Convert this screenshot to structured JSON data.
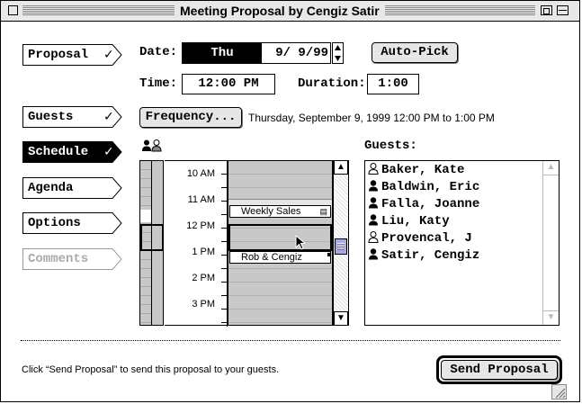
{
  "window": {
    "title": "Meeting Proposal by Cengiz Satir"
  },
  "nav": {
    "items": [
      {
        "label": "Proposal",
        "check": "✓",
        "selected": false,
        "disabled": false
      },
      {
        "label": "Guests",
        "check": "✓",
        "selected": false,
        "disabled": false
      },
      {
        "label": "Schedule",
        "check": "✓",
        "selected": true,
        "disabled": false
      },
      {
        "label": "Agenda",
        "check": "",
        "selected": false,
        "disabled": false
      },
      {
        "label": "Options",
        "check": "",
        "selected": false,
        "disabled": false
      },
      {
        "label": "Comments",
        "check": "",
        "selected": false,
        "disabled": true
      }
    ]
  },
  "proposal": {
    "date_label": "Date:",
    "day": "Thu",
    "date_value": "9/ 9/99",
    "auto_pick_label": "Auto-Pick",
    "time_label": "Time:",
    "time_value": "12:00 PM",
    "duration_label": "Duration:",
    "duration_value": "1:00",
    "frequency_label": "Frequency...",
    "summary": "Thursday, September 9, 1999 12:00 PM to  1:00 PM"
  },
  "schedule": {
    "times": [
      "10 AM",
      "11 AM",
      "12 PM",
      "1 PM",
      "2 PM",
      "3 PM"
    ],
    "events": [
      {
        "label": "Weekly Sales"
      },
      {
        "label": "Rob & Cengiz"
      }
    ]
  },
  "guests": {
    "label": "Guests:",
    "list": [
      {
        "name": "Baker, Kate",
        "icon": "person-outline-icon"
      },
      {
        "name": "Baldwin, Eric",
        "icon": "person-icon"
      },
      {
        "name": "Falla, Joanne",
        "icon": "person-icon"
      },
      {
        "name": "Liu, Katy",
        "icon": "person-icon"
      },
      {
        "name": "Provencal, J",
        "icon": "person-outline-icon"
      },
      {
        "name": "Satir, Cengiz",
        "icon": "person-icon"
      }
    ]
  },
  "footer": {
    "hint": "Click “Send Proposal” to send this proposal to your guests.",
    "send_label": "Send Proposal"
  }
}
